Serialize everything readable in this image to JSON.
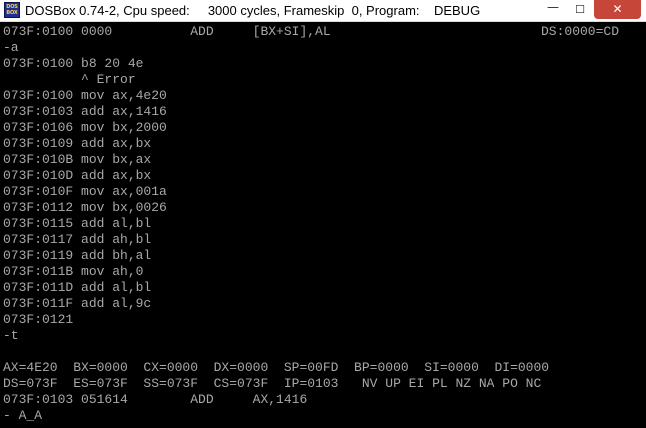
{
  "window": {
    "title": "DOSBox 0.74-2, Cpu speed:     3000 cycles, Frameskip  0, Program:    DEBUG",
    "icon_name": "dosbox-icon",
    "icon_text": "DOS BOX",
    "minimize_glyph": "—",
    "maximize_glyph": "☐",
    "close_glyph": "✕",
    "accent_close_color": "#c7463a"
  },
  "console": {
    "text_color": "#a8a8a8",
    "background": "#000000",
    "ds_readout": "DS:0000=CD",
    "lines": [
      "073F:0100 0000          ADD     [BX+SI],AL",
      "-a",
      "073F:0100 b8 20 4e",
      "          ^ Error",
      "073F:0100 mov ax,4e20",
      "073F:0103 add ax,1416",
      "073F:0106 mov bx,2000",
      "073F:0109 add ax,bx",
      "073F:010B mov bx,ax",
      "073F:010D add ax,bx",
      "073F:010F mov ax,001a",
      "073F:0112 mov bx,0026",
      "073F:0115 add al,bl",
      "073F:0117 add ah,bl",
      "073F:0119 add bh,al",
      "073F:011B mov ah,0",
      "073F:011D add al,bl",
      "073F:011F add al,9c",
      "073F:0121",
      "-t",
      "",
      "AX=4E20  BX=0000  CX=0000  DX=0000  SP=00FD  BP=0000  SI=0000  DI=0000",
      "DS=073F  ES=073F  SS=073F  CS=073F  IP=0103   NV UP EI PL NZ NA PO NC",
      "073F:0103 051614        ADD     AX,1416",
      "- A_A"
    ]
  }
}
